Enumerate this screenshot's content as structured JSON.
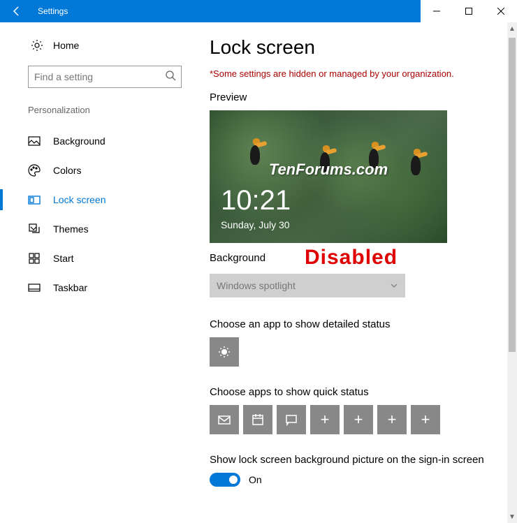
{
  "titlebar": {
    "title": "Settings"
  },
  "sidebar": {
    "home_label": "Home",
    "search_placeholder": "Find a setting",
    "group_header": "Personalization",
    "items": [
      {
        "label": "Background"
      },
      {
        "label": "Colors"
      },
      {
        "label": "Lock screen"
      },
      {
        "label": "Themes"
      },
      {
        "label": "Start"
      },
      {
        "label": "Taskbar"
      }
    ]
  },
  "main": {
    "title": "Lock screen",
    "warning": "*Some settings are hidden or managed by your organization.",
    "preview_label": "Preview",
    "preview": {
      "watermark": "TenForums.com",
      "time": "10:21",
      "date": "Sunday, July 30"
    },
    "background_label": "Background",
    "disabled_stamp": "Disabled",
    "background_dropdown_value": "Windows spotlight",
    "detailed_status_label": "Choose an app to show detailed status",
    "quick_status_label": "Choose apps to show quick status",
    "quick_status_icons": [
      "mail-icon",
      "calendar-icon",
      "message-icon",
      "plus-icon",
      "plus-icon",
      "plus-icon",
      "plus-icon"
    ],
    "signin_bg_label": "Show lock screen background picture on the sign-in screen",
    "signin_bg_toggle_state": "On"
  }
}
